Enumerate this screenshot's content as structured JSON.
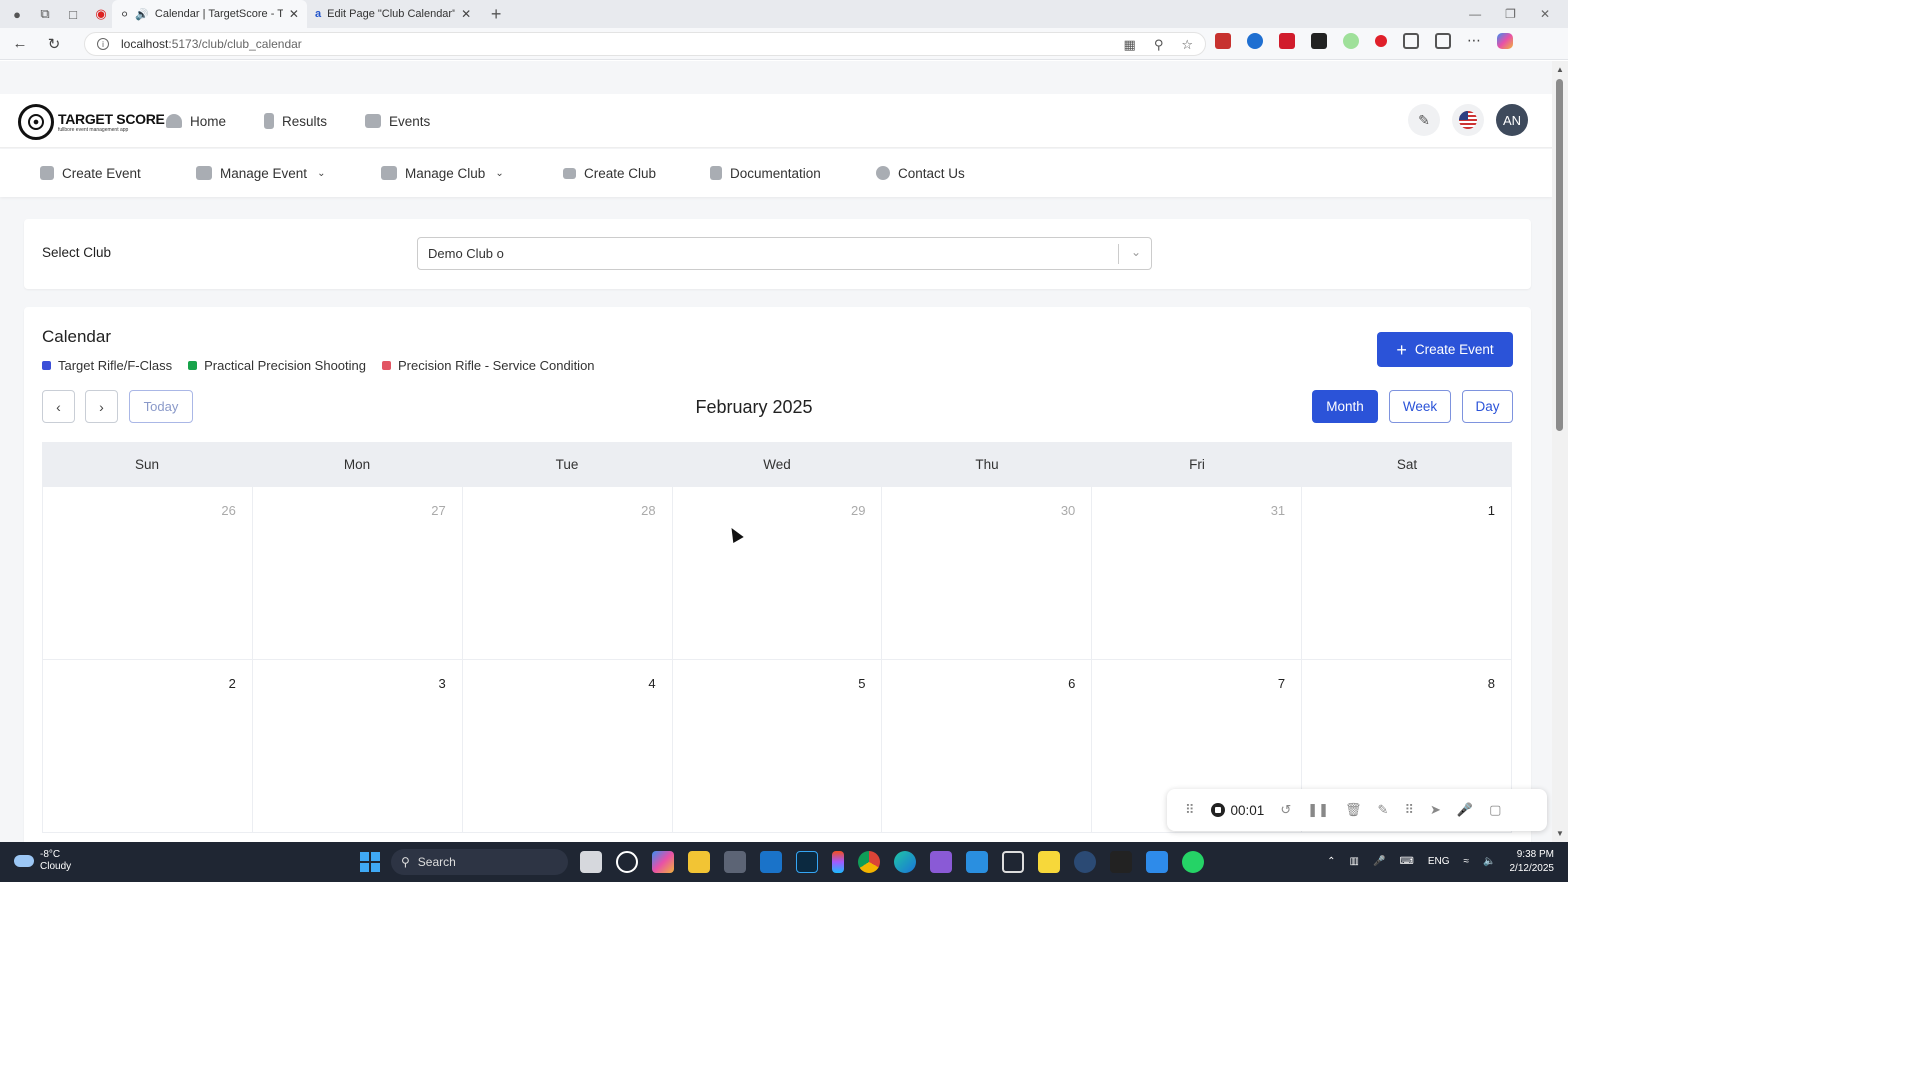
{
  "browser": {
    "tabs": [
      {
        "title": "Calendar | TargetScore - Targ",
        "active": true
      },
      {
        "title": "Edit Page \"Club Calendar\" ‹ Avtar",
        "active": false
      }
    ],
    "url_host": "localhost",
    "url_path": ":5173/club/club_calendar"
  },
  "app": {
    "logo_title": "TARGET SCORE",
    "logo_subtitle": "fullbore event management app",
    "main_nav": [
      "Home",
      "Results",
      "Events"
    ],
    "sub_nav": [
      {
        "label": "Create Event",
        "dropdown": false
      },
      {
        "label": "Manage Event",
        "dropdown": true
      },
      {
        "label": "Manage Club",
        "dropdown": true
      },
      {
        "label": "Create Club",
        "dropdown": false
      },
      {
        "label": "Documentation",
        "dropdown": false
      },
      {
        "label": "Contact Us",
        "dropdown": false
      }
    ],
    "avatar_initials": "AN"
  },
  "select_club": {
    "label": "Select Club",
    "value": "Demo Club o"
  },
  "calendar": {
    "title": "Calendar",
    "legend": [
      {
        "label": "Target Rifle/F-Class",
        "color": "#3b4fd8"
      },
      {
        "label": "Practical Precision Shooting",
        "color": "#17a34a"
      },
      {
        "label": "Precision Rifle - Service Condition",
        "color": "#e25563"
      }
    ],
    "create_button": "Create Event",
    "today_button": "Today",
    "month_label": "February 2025",
    "views": [
      "Month",
      "Week",
      "Day"
    ],
    "active_view": "Month",
    "weekdays": [
      "Sun",
      "Mon",
      "Tue",
      "Wed",
      "Thu",
      "Fri",
      "Sat"
    ],
    "weeks": [
      [
        {
          "d": "26",
          "other": true
        },
        {
          "d": "27",
          "other": true
        },
        {
          "d": "28",
          "other": true
        },
        {
          "d": "29",
          "other": true
        },
        {
          "d": "30",
          "other": true
        },
        {
          "d": "31",
          "other": true
        },
        {
          "d": "1",
          "other": false
        }
      ],
      [
        {
          "d": "2",
          "other": false
        },
        {
          "d": "3",
          "other": false
        },
        {
          "d": "4",
          "other": false
        },
        {
          "d": "5",
          "other": false
        },
        {
          "d": "6",
          "other": false
        },
        {
          "d": "7",
          "other": false
        },
        {
          "d": "8",
          "other": false
        }
      ]
    ]
  },
  "recorder": {
    "time": "00:01"
  },
  "taskbar": {
    "temp": "-8°C",
    "condition": "Cloudy",
    "search": "Search",
    "lang": "ENG",
    "time": "9:38 PM",
    "date": "2/12/2025"
  }
}
